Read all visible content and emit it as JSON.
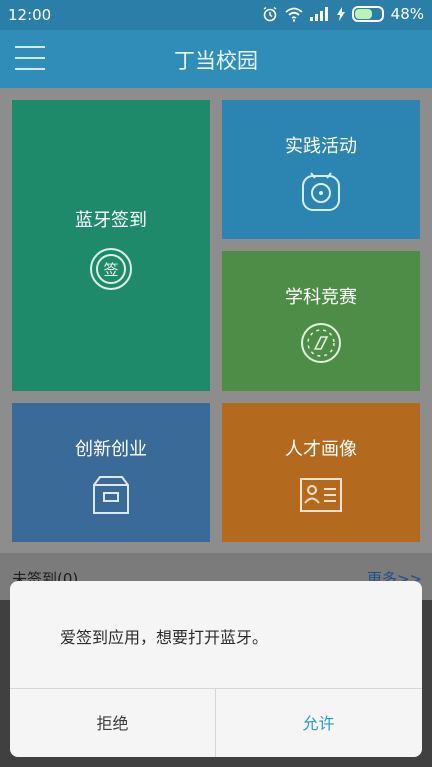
{
  "status_bar": {
    "time": "12:00",
    "battery": "48%"
  },
  "app": {
    "title": "丁当校园"
  },
  "tiles": [
    {
      "label": "蓝牙签到",
      "icon": "sign-in-icon",
      "icon_text": "签"
    },
    {
      "label": "实践活动",
      "icon": "activity-icon"
    },
    {
      "label": "学科竞赛",
      "icon": "compass-icon"
    },
    {
      "label": "创新创业",
      "icon": "box-icon"
    },
    {
      "label": "人才画像",
      "icon": "profile-card-icon"
    }
  ],
  "list_header": {
    "title": "未签到(0)",
    "more": "更多>>"
  },
  "dialog": {
    "message": "爱签到应用，想要打开蓝牙。",
    "deny": "拒绝",
    "allow": "允许"
  },
  "colors": {
    "statusbar": "#2b7ea8",
    "appbar": "#2f8db8",
    "tile_green": "#1f8a6a",
    "tile_blue": "#2c84b0",
    "tile_olive": "#4e8d48",
    "tile_slate": "#3a6a98",
    "tile_orange": "#b36a1f",
    "allow_text": "#2b9ad3"
  }
}
